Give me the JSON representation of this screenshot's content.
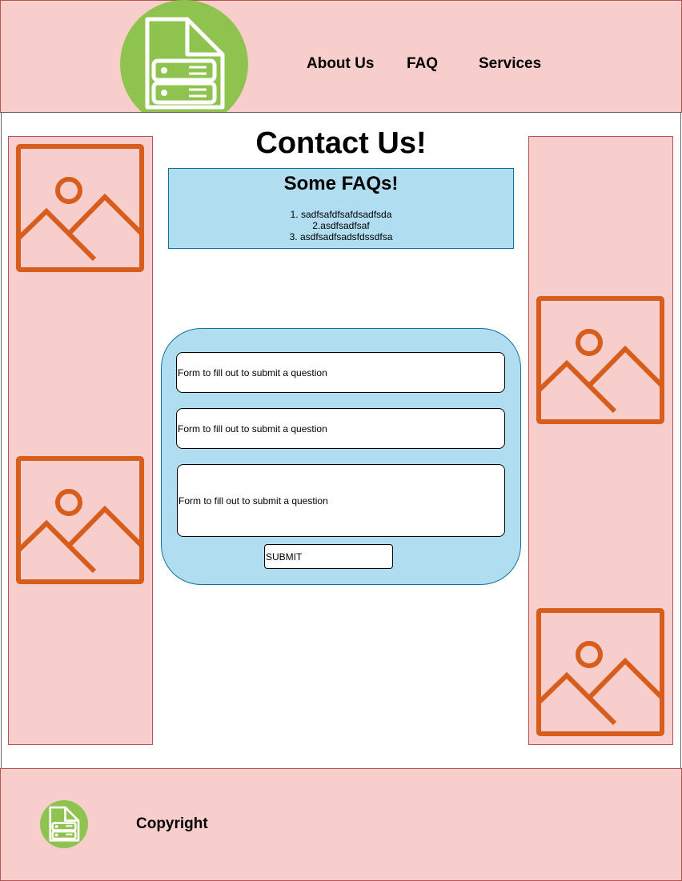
{
  "header": {
    "logo_icon": "document-server-icon",
    "nav": [
      {
        "label": "About Us"
      },
      {
        "label": "FAQ"
      },
      {
        "label": "Services"
      }
    ]
  },
  "main": {
    "title": "Contact Us!",
    "faq": {
      "title": "Some FAQs!",
      "items": [
        "1. sadfsafdfsafdsadfsda",
        "2.asdfsadfsaf",
        "3. asdfsadfsadsfdssdfsa"
      ]
    },
    "form": {
      "fields": [
        {
          "placeholder": "Form to fill out to submit a question"
        },
        {
          "placeholder": "Form to fill out to submit a question"
        },
        {
          "placeholder": "Form to fill out to submit a question"
        }
      ],
      "submit_label": "SUBMIT"
    }
  },
  "sidebars": {
    "image_icon": "image-placeholder-icon"
  },
  "footer": {
    "logo_icon": "document-server-icon",
    "copyright": "Copyright"
  },
  "colors": {
    "panel_fill": "#f8cecc",
    "panel_border": "#b85450",
    "logo_green": "#8fc34f",
    "box_blue": "#b1ddf0",
    "box_border": "#10739e",
    "icon_orange": "#d65d1c"
  }
}
